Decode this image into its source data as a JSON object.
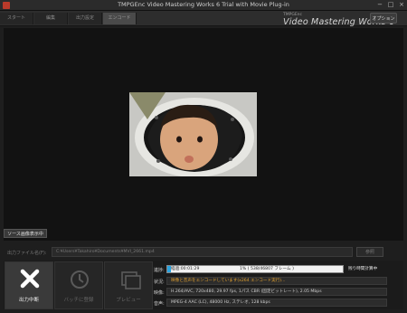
{
  "window": {
    "title": "TMPGEnc Video Mastering Works 6 Trial with Movie Plug-in",
    "minimize_glyph": "−",
    "maximize_glyph": "□",
    "close_glyph": "×"
  },
  "nav": {
    "tabs": [
      "スタート",
      "編集",
      "出力設定",
      "エンコード"
    ],
    "active_index": 3,
    "brand_small": "TMPGEnc",
    "brand_big": "Video Mastering Works 6",
    "option_label": "オプション"
  },
  "preview": {
    "source_button": "ソース画像表示中"
  },
  "output": {
    "file_label": "出力ファイル名(F):",
    "file_path": "C:¥Users¥Takahiro¥Documents¥MVI_2661.mp4",
    "browse_label": "参照"
  },
  "controls": {
    "stop_label": "出力中断",
    "batch_label": "バッチに登録",
    "preview_label": "プレビュー"
  },
  "status": {
    "progress_label": "進捗:",
    "elapsed": "経過:00:01:29",
    "progress_text": "1% ( 538/46807 フレーム )",
    "progress_fraction": 0.011,
    "remaining": "残り時間計算中",
    "state_label": "状況:",
    "state_value": "映像と音声をエンコードしています(x264 エンコード実行)...",
    "video_label": "映像:",
    "video_value": "H.264/AVC, 720x480, 29.97 fps, 1パス CBR (固定ビットレート), 2.05 Mbps",
    "audio_label": "音声:",
    "audio_value": "MPEG-4 AAC (LC), 48000 Hz, ステレオ, 128 kbps"
  },
  "colors": {
    "accent": "#29a3e0",
    "status_text": "#e0a030"
  }
}
